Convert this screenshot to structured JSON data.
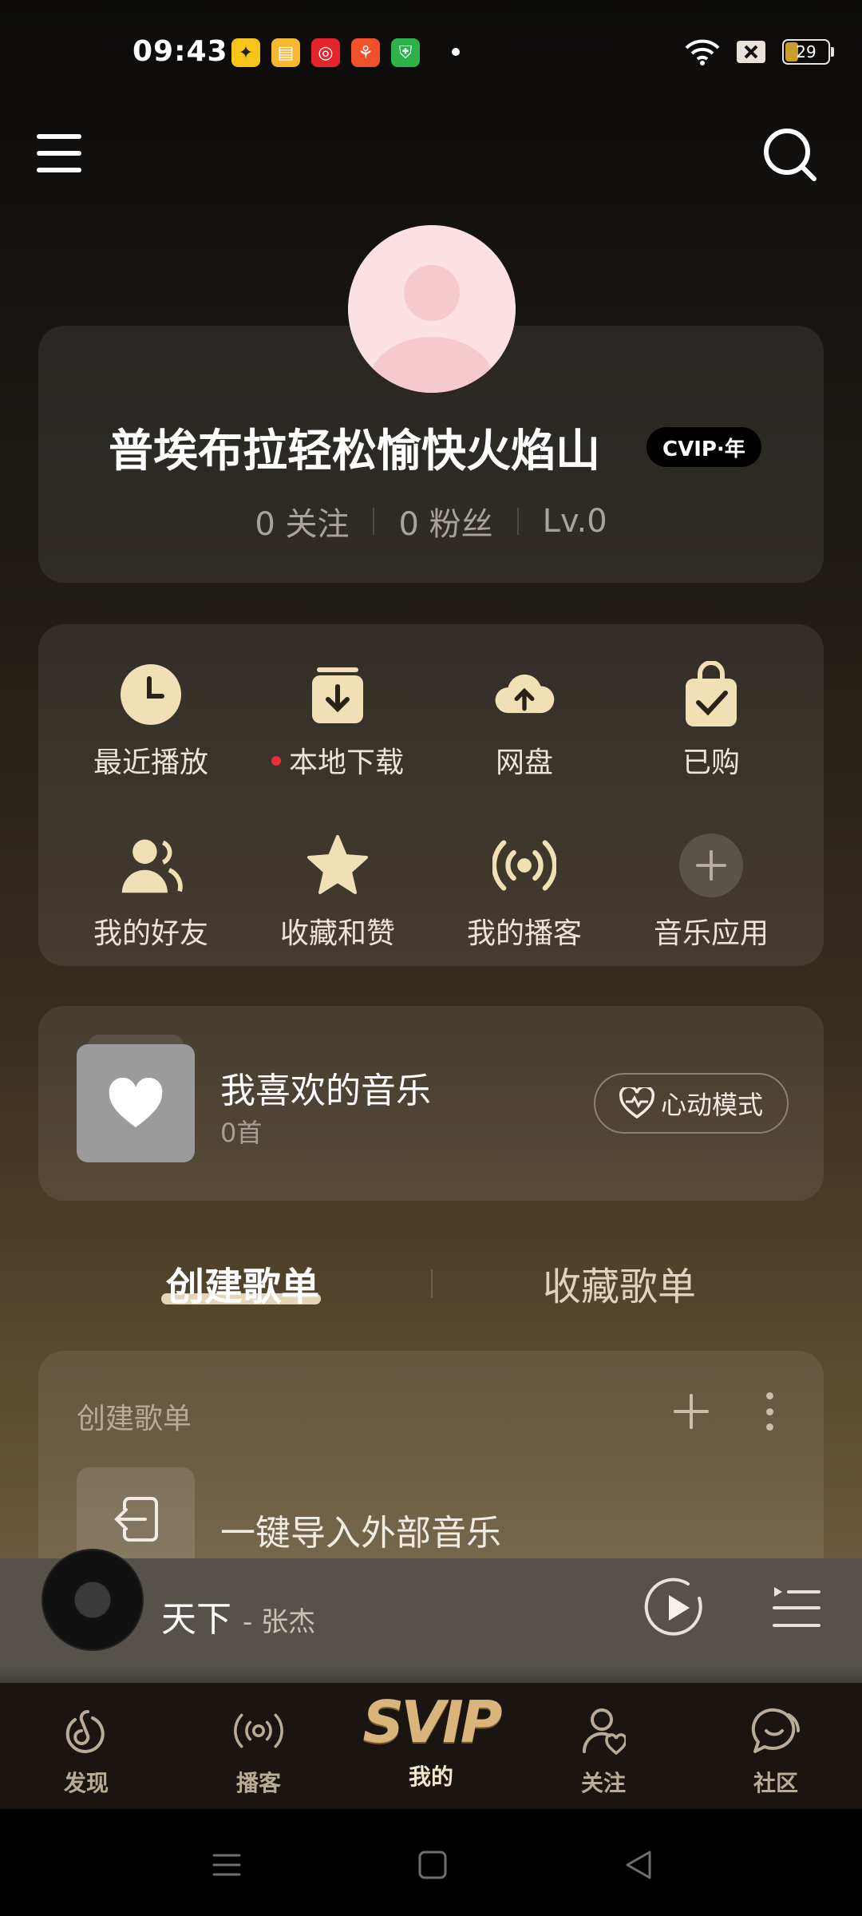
{
  "status_bar": {
    "time": "09:43",
    "battery": "29",
    "battery_level": 0.29
  },
  "profile": {
    "username": "普埃布拉轻松愉快火焰山",
    "vip_badge": "CVIP·年",
    "stats": [
      "0 关注",
      "0 粉丝",
      "Lv.0"
    ]
  },
  "quick_grid": [
    {
      "label": "最近播放",
      "icon": "clock-icon"
    },
    {
      "label": "本地下载",
      "icon": "download-icon",
      "dot": true
    },
    {
      "label": "网盘",
      "icon": "cloud-upload-icon"
    },
    {
      "label": "已购",
      "icon": "shopping-bag-check-icon"
    },
    {
      "label": "我的好友",
      "icon": "friends-icon"
    },
    {
      "label": "收藏和赞",
      "icon": "star-icon"
    },
    {
      "label": "我的播客",
      "icon": "broadcast-icon"
    },
    {
      "label": "音乐应用",
      "icon": "plus-circle-icon"
    }
  ],
  "liked_music": {
    "title": "我喜欢的音乐",
    "count": "0首",
    "heart_mode_label": "心动模式"
  },
  "playlist_tabs": {
    "created": "创建歌单",
    "collected": "收藏歌单"
  },
  "playlist_section": {
    "header": "创建歌单",
    "import_label": "一键导入外部音乐"
  },
  "mini_player": {
    "song": "天下",
    "artist": "- 张杰"
  },
  "bottom_nav": [
    {
      "label": "发现",
      "icon": "discover-icon"
    },
    {
      "label": "播客",
      "icon": "podcast-icon"
    },
    {
      "label": "我的",
      "icon": "svip-logo",
      "logo_text": "SVIP",
      "active": true
    },
    {
      "label": "关注",
      "icon": "follow-icon"
    },
    {
      "label": "社区",
      "icon": "community-icon"
    }
  ],
  "colors": {
    "accent_gold": "#f1dfb5",
    "red_dot": "#ea2e3a"
  }
}
